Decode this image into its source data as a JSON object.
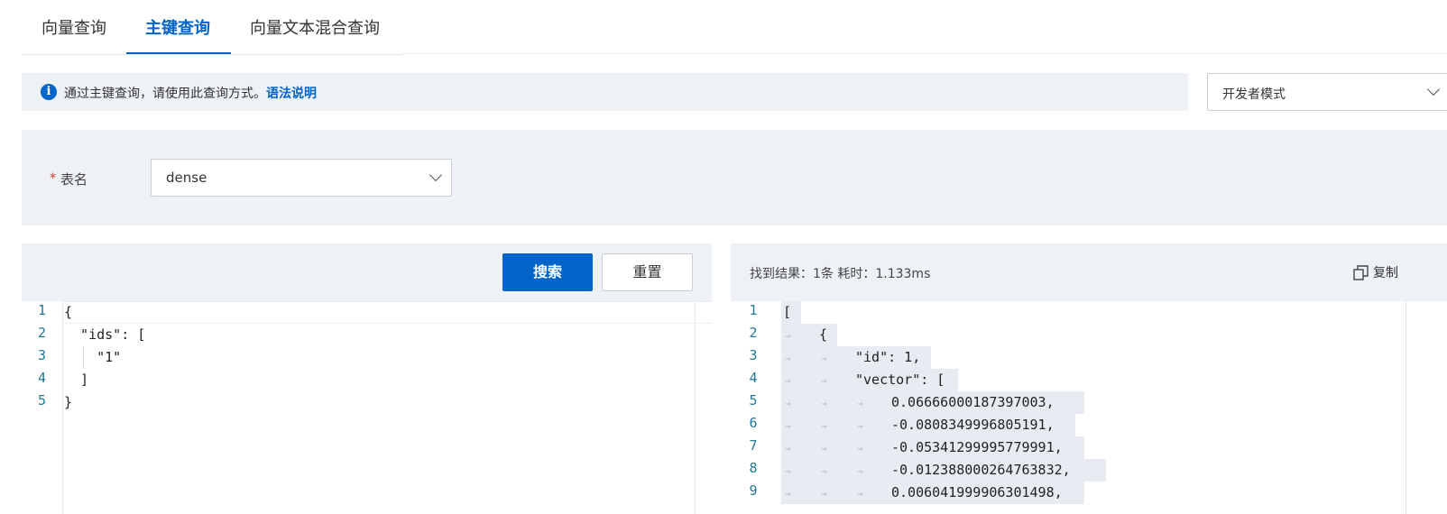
{
  "tabs": [
    {
      "label": "向量查询"
    },
    {
      "label": "主键查询"
    },
    {
      "label": "向量文本混合查询"
    }
  ],
  "active_tab": "主键查询",
  "info_bar": {
    "icon": "info-icon",
    "text": "通过主键查询，请使用此查询方式。",
    "link": "语法说明"
  },
  "mode_select": {
    "value": "开发者模式"
  },
  "form": {
    "table_label": "表名",
    "required_mark": "*",
    "table_value": "dense"
  },
  "buttons": {
    "search": "搜索",
    "reset": "重置"
  },
  "query_editor": {
    "line_numbers": [
      "1",
      "2",
      "3",
      "4",
      "5"
    ],
    "lines": [
      "{",
      "  \"ids\": [",
      "    \"1\"",
      "  ]",
      "}"
    ]
  },
  "result": {
    "summary": "找到结果：1条  耗时：1.133ms",
    "copy_label": "复制",
    "line_numbers": [
      "1",
      "2",
      "3",
      "4",
      "5",
      "6",
      "7",
      "8",
      "9"
    ],
    "lines": [
      "[",
      "{",
      "\"id\": 1,",
      "\"vector\": [",
      "0.06666000187397003,",
      "-0.0808349996805191,",
      "-0.05341299995779991,",
      "-0.012388000264763832,",
      "0.006041999906301498,"
    ]
  },
  "colors": {
    "accent": "#0064c8",
    "panel_bg": "#eef1f6",
    "line_number": "#237893"
  }
}
